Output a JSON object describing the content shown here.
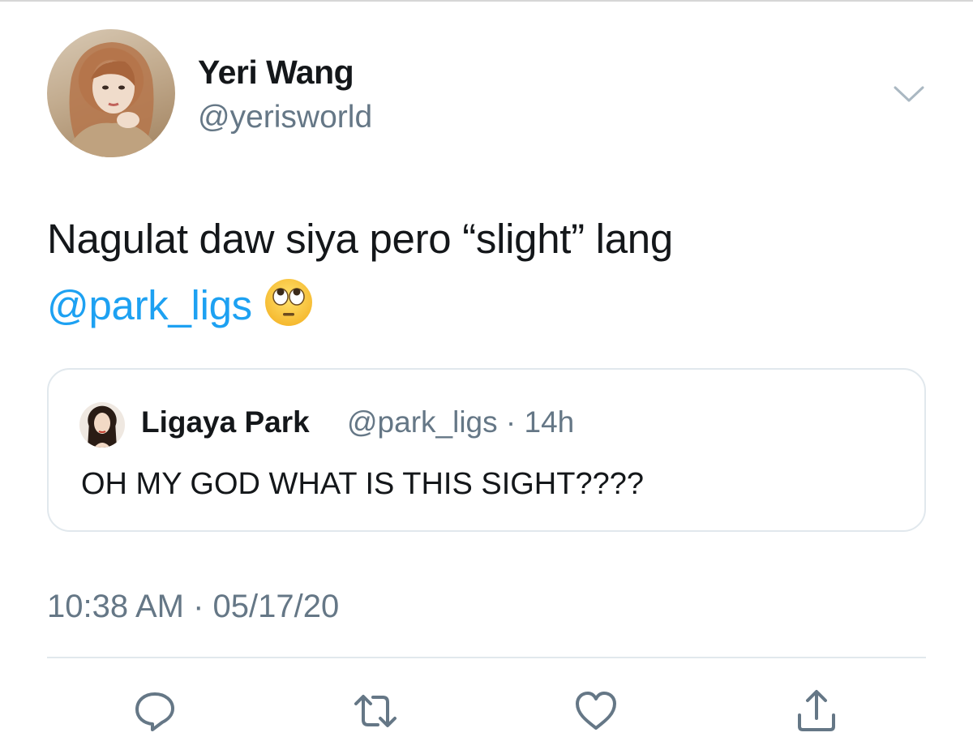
{
  "author": {
    "name": "Yeri Wang",
    "handle": "@yerisworld"
  },
  "tweet": {
    "text_line1": "Nagulat daw siya pero “slight” lang",
    "mention": "@park_ligs",
    "emoji": "face-with-rolling-eyes"
  },
  "quoted_tweet": {
    "author_name": "Ligaya Park",
    "author_handle": "@park_ligs",
    "separator": "·",
    "age": "14h",
    "text": "OH MY GOD WHAT IS THIS SIGHT????"
  },
  "timestamp": "10:38 AM · 05/17/20",
  "actions": {
    "reply_icon": "reply-icon",
    "retweet_icon": "retweet-icon",
    "like_icon": "heart-icon",
    "share_icon": "share-icon"
  },
  "colors": {
    "link": "#1da1f2",
    "secondary_text": "#657786",
    "divider": "#e1e8ed"
  }
}
